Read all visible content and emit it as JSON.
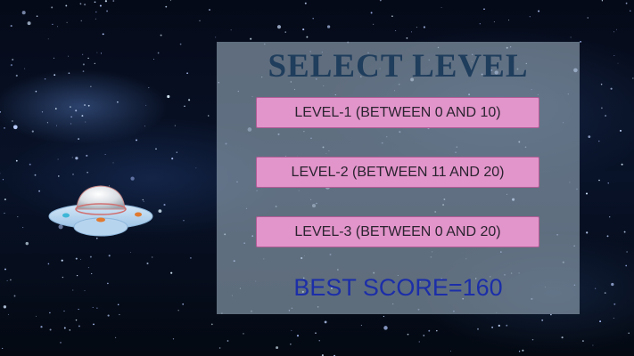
{
  "menu": {
    "title": "SELECT LEVEL",
    "levels": [
      {
        "label": "LEVEL-1 (BETWEEN 0 AND 10)"
      },
      {
        "label": "LEVEL-2 (BETWEEN 11 AND 20)"
      },
      {
        "label": "LEVEL-3 (BETWEEN 0 AND 20)"
      }
    ],
    "best_score": "BEST SCORE=160"
  },
  "colors": {
    "title": "#1f3d5c",
    "button_fill": "#e295ca",
    "best_score_text": "#1c2ea8"
  },
  "icons": {
    "player_ship": "ufo-icon"
  }
}
